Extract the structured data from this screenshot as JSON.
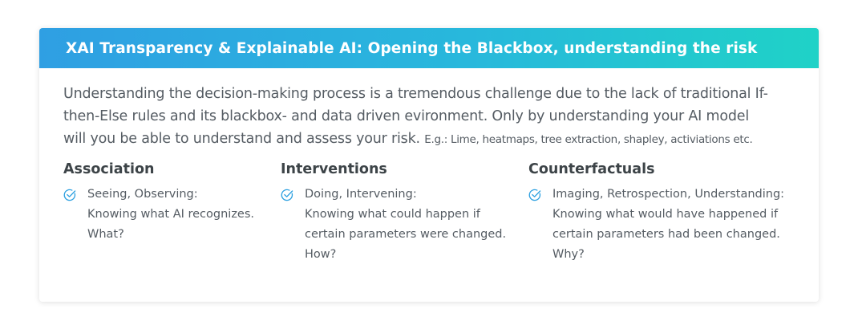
{
  "colors": {
    "header_gradient_start": "#2f9fe3",
    "header_gradient_end": "#1fd2c7",
    "check_icon": "#2a9fe0",
    "body_text": "#555c63",
    "heading_text": "#3d4448"
  },
  "header": {
    "title": "XAI Transparency & Explainable AI: Opening the Blackbox, understanding the risk"
  },
  "intro": {
    "line1": "Understanding the decision-making process is a tremendous challenge due to the lack of traditional If-",
    "line2": "then-Else rules and its blackbox- and data driven evironment. Only by understanding your AI model",
    "line3": "will you be able to understand and assess your risk.",
    "examples": "E.g.: Lime, heatmaps, tree extraction, shapley, activiations etc."
  },
  "columns": [
    {
      "title": "Association",
      "icon": "check-circle-icon",
      "lines": [
        "Seeing, Observing:",
        "Knowing what AI recognizes.",
        "What?"
      ]
    },
    {
      "title": "Interventions",
      "icon": "check-circle-icon",
      "lines": [
        "Doing, Intervening:",
        "Knowing what could happen if",
        "certain parameters were changed.",
        "How?"
      ]
    },
    {
      "title": "Counterfactuals",
      "icon": "check-circle-icon",
      "lines": [
        "Imaging, Retrospection, Understanding:",
        "Knowing what would have happened if",
        "certain parameters had been changed.",
        "Why?"
      ]
    }
  ]
}
